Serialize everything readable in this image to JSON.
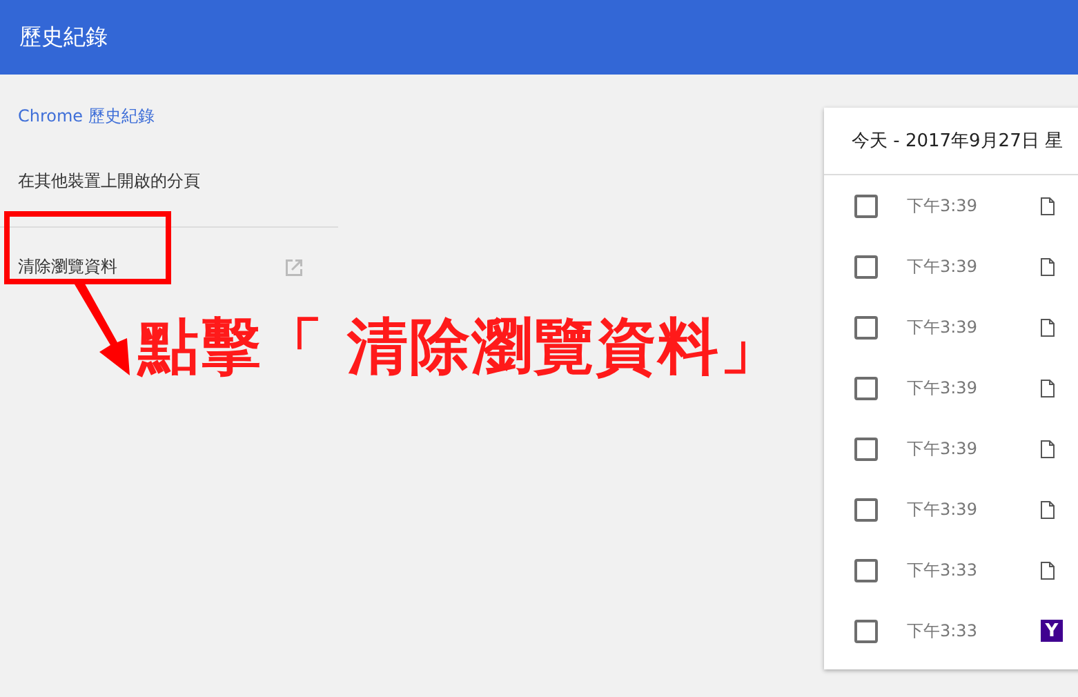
{
  "header": {
    "title": "歷史紀錄"
  },
  "sidebar": {
    "items": [
      {
        "label": "Chrome 歷史紀錄",
        "selected": true
      },
      {
        "label": "在其他裝置上開啟的分頁",
        "selected": false
      }
    ],
    "clear_link": {
      "label": "清除瀏覽資料"
    }
  },
  "history": {
    "date_heading": "今天 - 2017年9月27日 星",
    "rows": [
      {
        "time": "下午3:39",
        "checked": false,
        "kind": "page"
      },
      {
        "time": "下午3:39",
        "checked": false,
        "kind": "page"
      },
      {
        "time": "下午3:39",
        "checked": false,
        "kind": "page"
      },
      {
        "time": "下午3:39",
        "checked": false,
        "kind": "page"
      },
      {
        "time": "下午3:39",
        "checked": false,
        "kind": "page"
      },
      {
        "time": "下午3:39",
        "checked": false,
        "kind": "page"
      },
      {
        "time": "下午3:33",
        "checked": false,
        "kind": "page"
      },
      {
        "time": "下午3:33",
        "checked": false,
        "kind": "site",
        "favicon_letter": "Y"
      }
    ]
  },
  "annotation": {
    "text": "點擊「 清除瀏覽資料」"
  }
}
